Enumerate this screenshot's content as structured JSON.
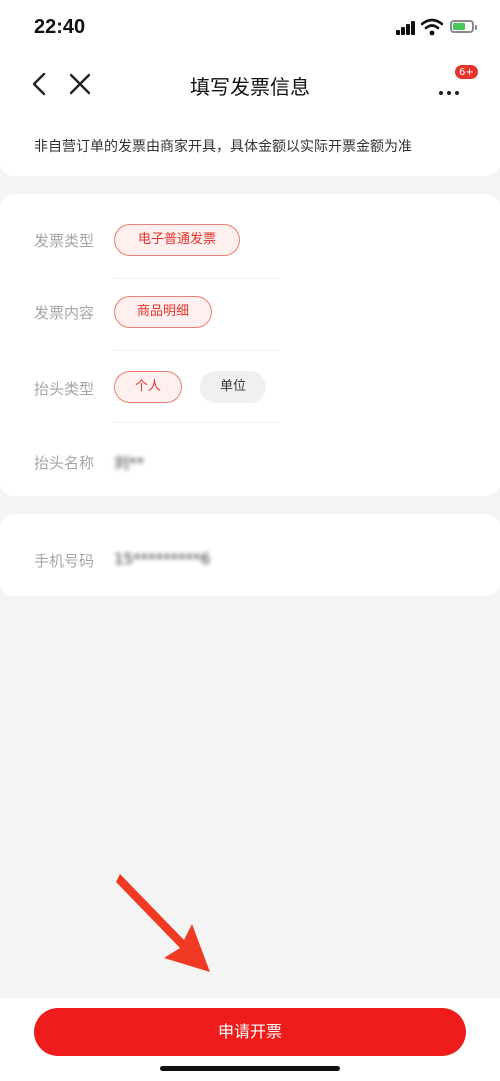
{
  "status_bar": {
    "time": "22:40",
    "icons": [
      "signal-icon",
      "wifi-icon",
      "battery-icon"
    ]
  },
  "nav": {
    "title": "填写发票信息",
    "badge": "6+",
    "icons": [
      "back-icon",
      "close-icon",
      "more-icon"
    ]
  },
  "notice": {
    "text": "非自营订单的发票由商家开具，具体金额以实际开票金额为准"
  },
  "invoice": {
    "type_label": "发票类型",
    "type_value": "电子普通发票",
    "content_label": "发票内容",
    "content_value": "商品明细",
    "title_type_label": "抬头类型",
    "title_type_options": [
      "个人",
      "单位"
    ],
    "title_type_selected": "个人",
    "title_name_label": "抬头名称",
    "title_name_value": "刘**"
  },
  "phone": {
    "label": "手机号码",
    "value": "15*********6"
  },
  "footer": {
    "submit_label": "申请开票"
  },
  "colors": {
    "accent": "#ee1d1b",
    "selected_chip_bg": "#fdf0ee",
    "page_bg": "#f4f4f4"
  }
}
